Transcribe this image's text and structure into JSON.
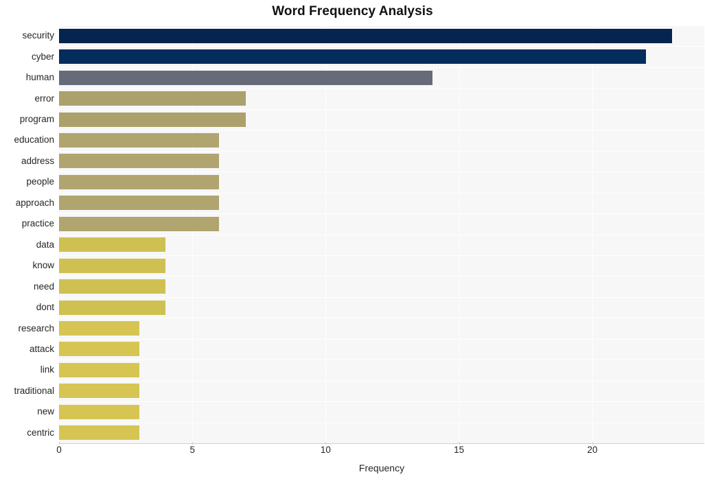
{
  "chart_data": {
    "type": "bar",
    "orientation": "horizontal",
    "title": "Word Frequency Analysis",
    "xlabel": "Frequency",
    "ylabel": "",
    "categories": [
      "security",
      "cyber",
      "human",
      "error",
      "program",
      "education",
      "address",
      "people",
      "approach",
      "practice",
      "data",
      "know",
      "need",
      "dont",
      "research",
      "attack",
      "link",
      "traditional",
      "new",
      "centric"
    ],
    "values": [
      23,
      22,
      14,
      7,
      7,
      6,
      6,
      6,
      6,
      6,
      4,
      4,
      4,
      4,
      3,
      3,
      3,
      3,
      3,
      3
    ],
    "bar_colors": [
      "#052450",
      "#042d5e",
      "#666b77",
      "#aca06c",
      "#aca06c",
      "#b0a56f",
      "#b0a56f",
      "#b0a56f",
      "#b0a56f",
      "#b0a56f",
      "#cec152",
      "#cec152",
      "#cec152",
      "#cec152",
      "#d6c552",
      "#d6c552",
      "#d6c552",
      "#d6c552",
      "#d6c552",
      "#d6c552"
    ],
    "xlim": [
      0,
      24.2
    ],
    "xticks": [
      0,
      5,
      10,
      15,
      20
    ],
    "xticklabels": [
      "0",
      "5",
      "10",
      "15",
      "20"
    ],
    "grid": true,
    "grid_color": "#ffffff",
    "plot_background": "#f7f7f8",
    "figure_background": "#ffffff",
    "legend": null
  }
}
